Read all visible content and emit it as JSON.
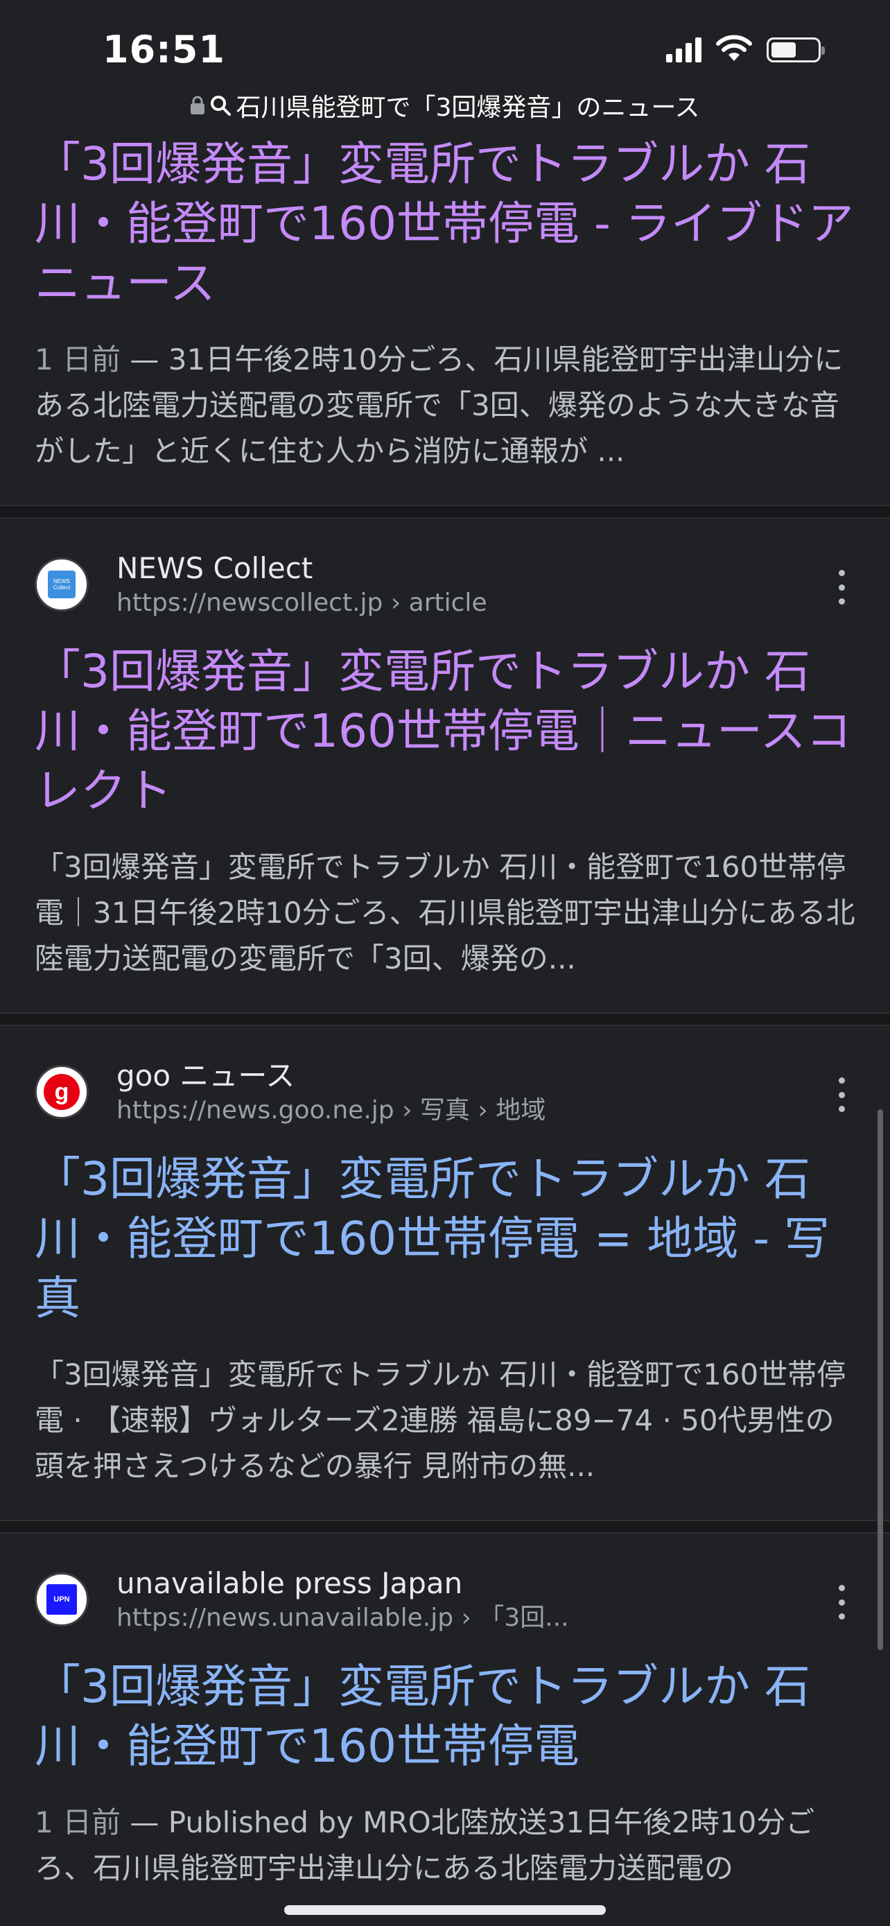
{
  "status_bar": {
    "time": "16:51",
    "battery_level": 0.55
  },
  "url_bar": {
    "text": "石川県能登町で「3回爆発音」のニュース"
  },
  "results": [
    {
      "title": "「3回爆発音」変電所でトラブルか 石川・能登町で160世帯停電 - ライブドアニュース",
      "date": "1 日前",
      "snippet": "31日午後2時10分ごろ、石川県能登町宇出津山分にある北陸電力送配電の変電所で「3回、爆発のような大きな音がした」と近くに住む人から消防に通報が ..."
    },
    {
      "site_name": "NEWS Collect",
      "url": "https://newscollect.jp › article",
      "favicon_text": "NEWS Collect",
      "title": "「3回爆発音」変電所でトラブルか 石川・能登町で160世帯停電｜ニュースコレクト",
      "snippet": "「3回爆発音」変電所でトラブルか 石川・能登町で160世帯停電｜31日午後2時10分ごろ、石川県能登町宇出津山分にある北陸電力送配電の変電所で「3回、爆発の..."
    },
    {
      "site_name": "goo ニュース",
      "url": "https://news.goo.ne.jp › 写真 › 地域",
      "favicon_text": "g",
      "title": "「3回爆発音」変電所でトラブルか 石川・能登町で160世帯停電 = 地域 - 写真",
      "snippet": "「3回爆発音」変電所でトラブルか 石川・能登町で160世帯停電 · 【速報】ヴォルターズ2連勝 福島に89−74 · 50代男性の頭を押さえつけるなどの暴行 見附市の無..."
    },
    {
      "site_name": "unavailable press Japan",
      "url": "https://news.unavailable.jp › 「3回...",
      "favicon_text": "UPN",
      "title": "「3回爆発音」変電所でトラブルか 石川・能登町で160世帯停電",
      "date": "1 日前",
      "snippet": "Published by MRO北陸放送31日午後2時10分ごろ、石川県能登町宇出津山分にある北陸電力送配電の"
    }
  ],
  "colors": {
    "background": "#202124",
    "visited_link": "#c58af9",
    "link": "#8ab4f8",
    "snippet": "#bdc1c6",
    "url": "#9aa0a6"
  }
}
